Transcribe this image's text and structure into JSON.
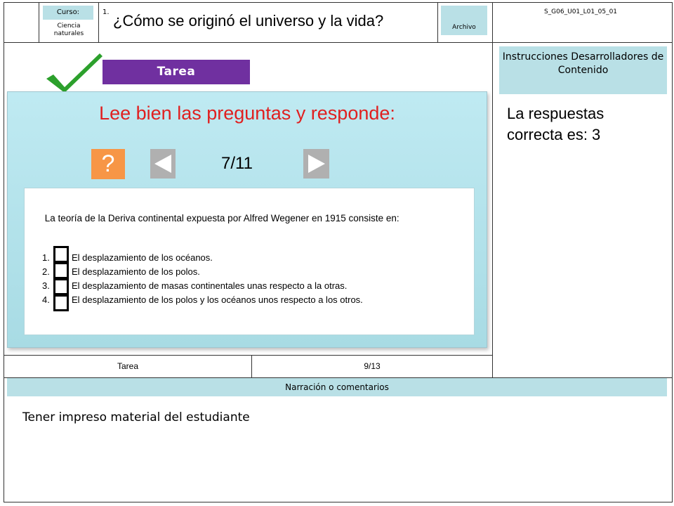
{
  "header": {
    "curso_label": "Curso:",
    "curso_value": "Ciencia naturales",
    "number": "1.",
    "title": "¿Cómo se originó el universo y la vida?",
    "archivo_label": "Archivo",
    "code": "S_G06_U01_L01_05_01"
  },
  "slide": {
    "tab_label": "Tarea",
    "heading": "Lee bien las preguntas y responde:",
    "help_label": "?",
    "counter": "7/11",
    "question": "La teoría de la Deriva continental expuesta por Alfred Wegener en 1915 consiste en:",
    "options": [
      {
        "num": "1.",
        "text": "El desplazamiento de los océanos."
      },
      {
        "num": "2.",
        "text": "El desplazamiento de los polos."
      },
      {
        "num": "3.",
        "text": "El desplazamiento de masas continentales unas respecto a la otras."
      },
      {
        "num": "4.",
        "text": "El desplazamiento de los polos y los océanos unos respecto a los otros."
      }
    ]
  },
  "footer_row": {
    "type_label": "Tarea",
    "page": "9/13"
  },
  "sidebar": {
    "instructions": "Instrucciones Desarrolladores de Contenido",
    "answer": "La respuestas correcta es: 3"
  },
  "narration": {
    "header": "Narración o comentarios",
    "text": "Tener impreso material del estudiante"
  },
  "colors": {
    "accent_purple": "#7030a0",
    "heading_red": "#e02020",
    "checkmark_green": "#2ca02c",
    "help_orange": "#f79646",
    "label_blue": "#b9e0e6"
  }
}
